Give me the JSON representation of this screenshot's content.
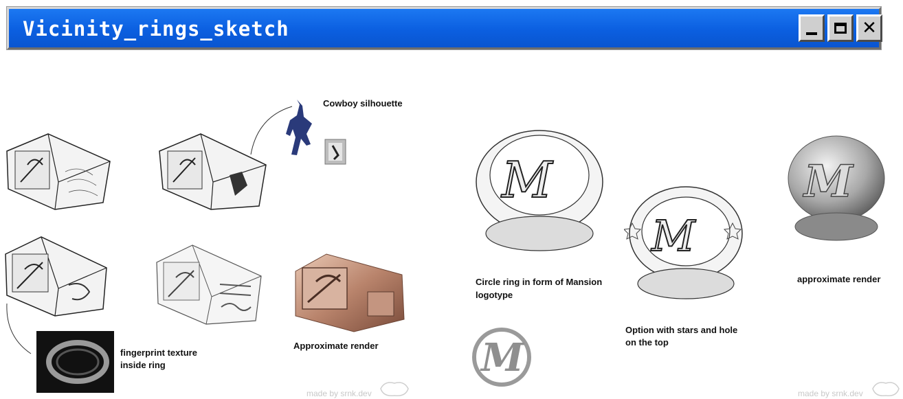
{
  "window": {
    "title": "Vicinity_rings_sketch",
    "buttons": {
      "minimize": "minimize-icon",
      "maximize": "maximize-icon",
      "close": "close-icon"
    },
    "colors": {
      "titlebar": "#0a5bd8",
      "button_face": "#cfcfcf"
    }
  },
  "sketches": {
    "labels": {
      "cowboy": "Cowboy silhouette",
      "fingerprint_line1": "fingerprint texture",
      "fingerprint_line2": "inside ring",
      "approx_render_square": "Approximate render",
      "circle_ring_line1": "Circle ring in form of Mansion",
      "circle_ring_line2": "logotype",
      "stars_option_line1": "Option with stars and hole",
      "stars_option_line2": "on the top",
      "approx_render_circle": "approximate render"
    },
    "watermarks": [
      "made by srnk.dev",
      "made by srnk.dev"
    ]
  }
}
